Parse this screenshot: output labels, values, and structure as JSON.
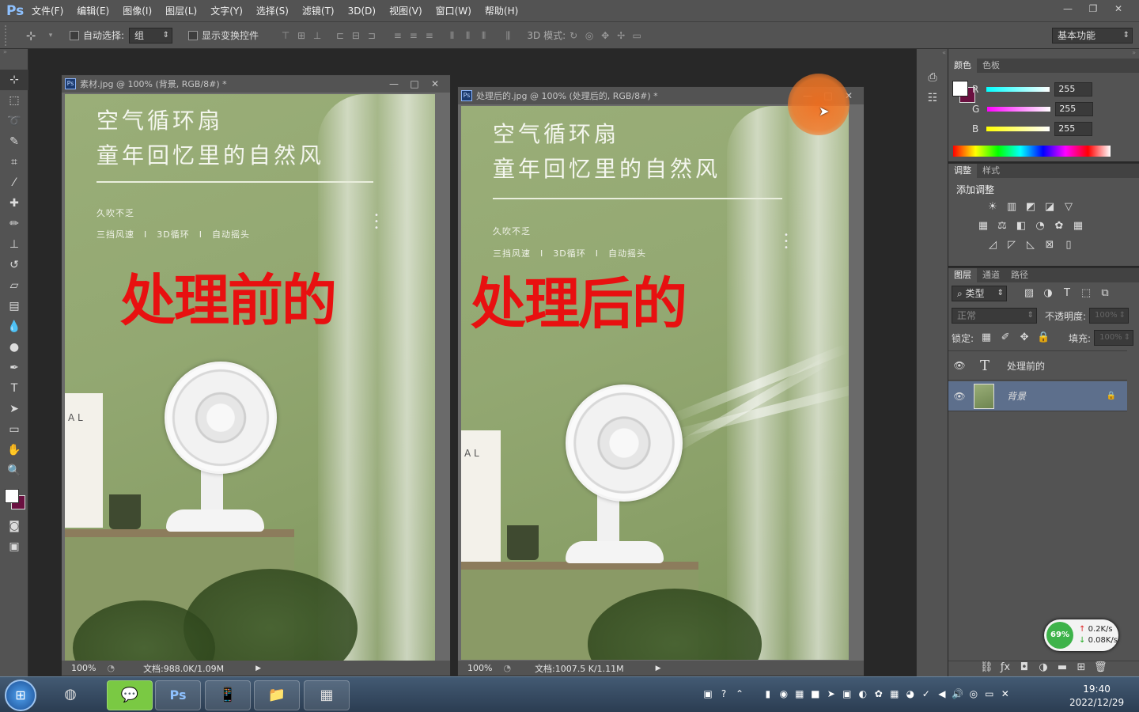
{
  "app": {
    "logo": "Ps"
  },
  "menu": [
    "文件(F)",
    "编辑(E)",
    "图像(I)",
    "图层(L)",
    "文字(Y)",
    "选择(S)",
    "滤镜(T)",
    "3D(D)",
    "视图(V)",
    "窗口(W)",
    "帮助(H)"
  ],
  "options": {
    "auto_select_label": "自动选择:",
    "auto_select_value": "组",
    "show_transform_label": "显示变换控件",
    "mode_3d_label": "3D 模式:",
    "workspace": "基本功能"
  },
  "doc1": {
    "title": "素材.jpg @ 100% (背景, RGB/8#) *",
    "zoom": "100%",
    "doc_info": "文档:988.0K/1.09M",
    "heading1": "空气循环扇",
    "heading2": "童年回忆里的自然风",
    "line1": "久吹不乏",
    "line2": "三挡风速　I　3D循环　I　自动摇头",
    "overlay": "处理前的",
    "card_letter": "A L"
  },
  "doc2": {
    "title": "处理后的.jpg @ 100% (处理后的, RGB/8#) *",
    "zoom": "100%",
    "doc_info": "文档:1007.5 K/1.11M",
    "heading1": "空气循环扇",
    "heading2": "童年回忆里的自然风",
    "line1": "久吹不乏",
    "line2": "三挡风速　I　3D循环　I　自动摇头",
    "overlay": "处理后的",
    "card_letter": "A L"
  },
  "color_panel": {
    "tabs": [
      "颜色",
      "色板"
    ],
    "r_label": "R",
    "g_label": "G",
    "b_label": "B",
    "r": "255",
    "g": "255",
    "b": "255",
    "foreground": "#ffffff",
    "background": "#6a1040"
  },
  "adjust_panel": {
    "tabs": [
      "调整",
      "样式"
    ],
    "title": "添加调整"
  },
  "layers_panel": {
    "tabs": [
      "图层",
      "通道",
      "路径"
    ],
    "filter": "类型",
    "blend_mode": "正常",
    "opacity_label": "不透明度:",
    "opacity": "100%",
    "lock_label": "锁定:",
    "fill_label": "填充:",
    "fill": "100%",
    "layers": [
      {
        "name": "处理前的",
        "type": "text"
      },
      {
        "name": "背景",
        "type": "image",
        "locked": true
      }
    ]
  },
  "network": {
    "percent": "69%",
    "up": "0.2K/s",
    "down": "0.08K/s"
  },
  "taskbar": {
    "time": "19:40",
    "date": "2022/12/29"
  }
}
